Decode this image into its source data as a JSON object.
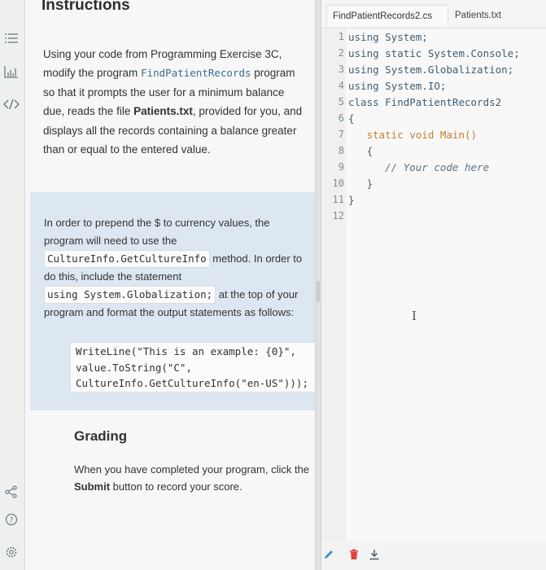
{
  "instructions": {
    "title": "Instructions",
    "para1_a": "Using your code from Programming Exercise 3C, modify the program ",
    "para1_code": "FindPatientRecords",
    "para1_b": " program so that it prompts the user for a minimum balance due, reads the file ",
    "para1_bold": "Patients.txt",
    "para1_c": ", provided for you, and displays all the records containing a balance greater than or equal to the entered value.",
    "para2_a": "In order to prepend the $ to currency values, the program will need to use the ",
    "para2_code1": "CultureInfo.GetCultureInfo",
    "para2_b": " method. In order to do this, include the statement ",
    "para2_code2": "using System.Globalization;",
    "para2_c": " at the top of your program and format the output statements as follows:",
    "example_line1": "WriteLine(\"This is an example: {0}\",",
    "example_line2": "value.ToString(\"C\",",
    "example_line3": "CultureInfo.GetCultureInfo(\"en-US\")));",
    "grading_title": "Grading",
    "para3_a": "When you have completed your program, click the ",
    "para3_bold": "Submit",
    "para3_b": " button to record your score."
  },
  "rail_icons": [
    "menu-list-icon",
    "chart-icon",
    "code-icon",
    "share-icon",
    "help-icon",
    "settings-icon"
  ],
  "editor": {
    "tabs": [
      "FindPatientRecords2.cs",
      "Patients.txt"
    ],
    "active_tab": "FindPatientRecords2.cs",
    "line_numbers": [
      "1",
      "2",
      "3",
      "4",
      "5",
      "6",
      "7",
      "8",
      "9",
      "10",
      "11",
      "12"
    ],
    "lines": [
      "using System;",
      "using static System.Console;",
      "using System.Globalization;",
      "using System.IO;",
      "class FindPatientRecords2",
      "{",
      "   static void Main()",
      "   {",
      "      // Your code here",
      "   }",
      "}",
      ""
    ]
  },
  "colors": {
    "info_box": "#dde7f2",
    "keyword": "#3f5d75",
    "method": "#c97d2c",
    "pencil": "#3b8ccf",
    "trash": "#e0433c",
    "download": "#4a5a62"
  }
}
